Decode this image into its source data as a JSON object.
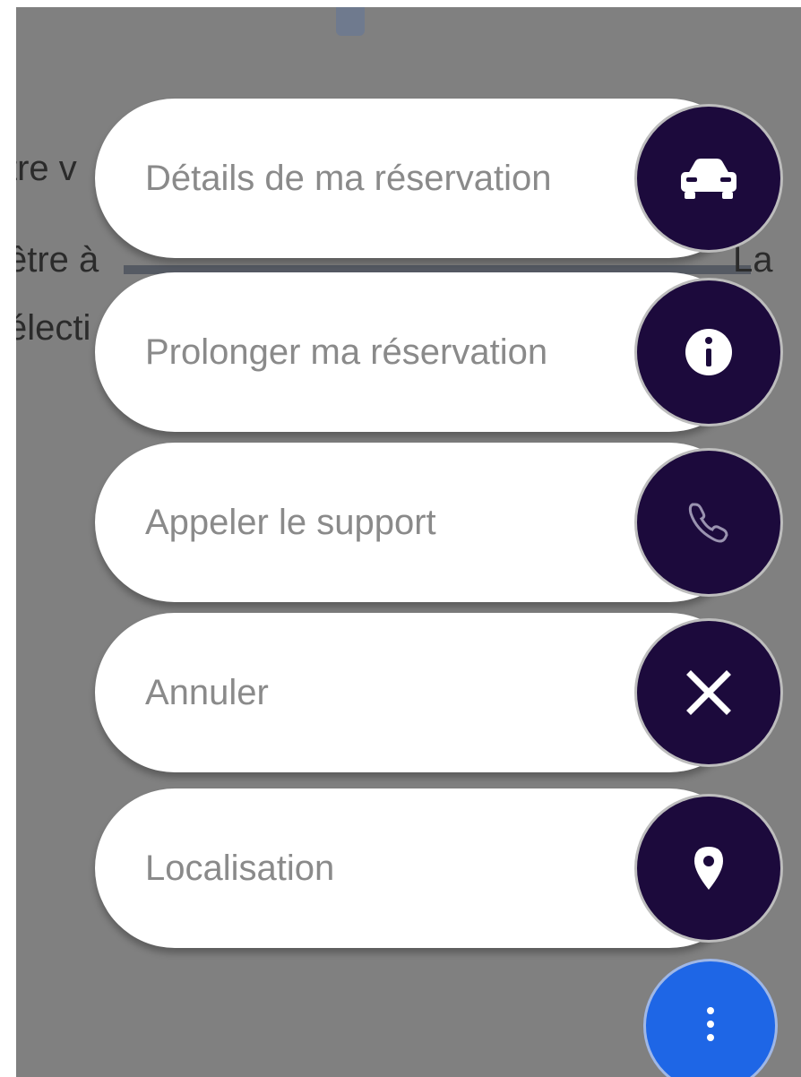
{
  "background": {
    "text_line_1": "tre v",
    "text_line_2": "être à",
    "text_line_2_end": "La",
    "text_line_3": "électi"
  },
  "menu": {
    "items": [
      {
        "label": "Détails de ma réservation",
        "icon": "car-icon"
      },
      {
        "label": "Prolonger ma réservation",
        "icon": "info-icon"
      },
      {
        "label": "Appeler le support",
        "icon": "phone-icon"
      },
      {
        "label": "Annuler",
        "icon": "close-icon"
      },
      {
        "label": "Localisation",
        "icon": "location-pin-icon"
      }
    ]
  },
  "fab": {
    "icon": "more-vertical-icon"
  },
  "colors": {
    "overlay": "#808080",
    "icon_circle": "#1c0a3c",
    "fab": "#1e66e6",
    "label": "#8a8a8a"
  }
}
